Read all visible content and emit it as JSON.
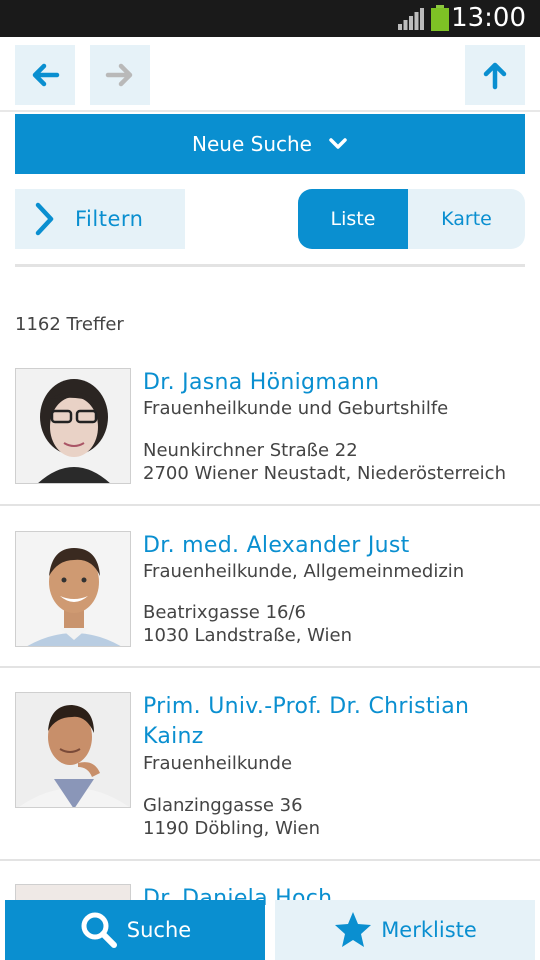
{
  "status_bar": {
    "time": "13:00"
  },
  "nav": {
    "back_icon": "arrow-left-icon",
    "forward_icon": "arrow-right-icon",
    "up_icon": "arrow-up-icon"
  },
  "search": {
    "new_search_label": "Neue Suche"
  },
  "filter": {
    "label": "Filtern"
  },
  "view_toggle": {
    "list_label": "Liste",
    "map_label": "Karte",
    "selected": "Liste"
  },
  "results": {
    "count_text": "1162 Treffer",
    "items": [
      {
        "name": "Dr. Jasna Hönigmann",
        "specialty": "Frauenheilkunde und Geburtshilfe",
        "street": "Neunkirchner Straße 22",
        "city": "2700 Wiener Neustadt, Niederösterreich"
      },
      {
        "name": "Dr. med. Alexander Just",
        "specialty": "Frauenheilkunde, Allgemeinmedizin",
        "street": "Beatrixgasse 16/6",
        "city": "1030 Landstraße, Wien"
      },
      {
        "name": "Prim. Univ.-Prof. Dr. Christian Kainz",
        "specialty": "Frauenheilkunde",
        "street": "Glanzinggasse 36",
        "city": "1190 Döbling, Wien"
      },
      {
        "name": "Dr. Daniela Hoch",
        "specialty": "",
        "street": "",
        "city": ""
      }
    ]
  },
  "bottom_tabs": {
    "search_label": "Suche",
    "favorites_label": "Merkliste"
  },
  "colors": {
    "accent": "#0a8fd0",
    "light_accent": "#e6f2f8",
    "status_bar": "#1a1a1a",
    "battery": "#7ec225"
  }
}
